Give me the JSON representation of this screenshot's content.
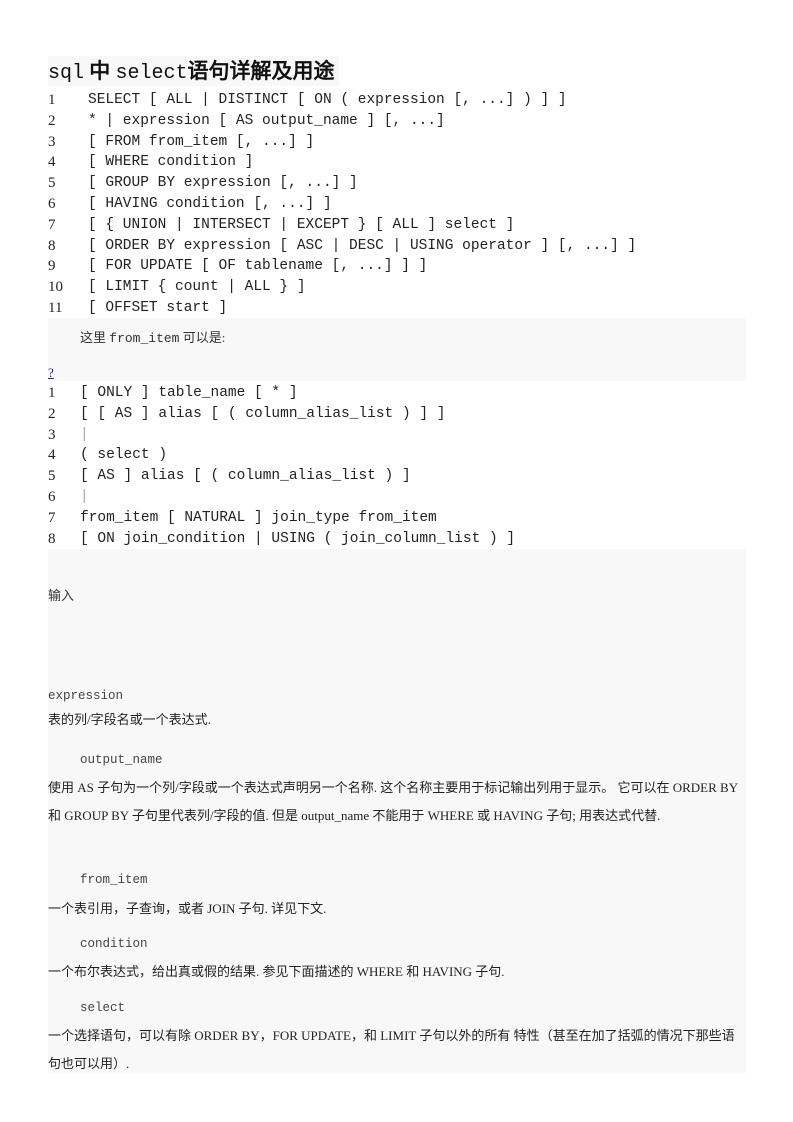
{
  "document": {
    "title": {
      "part1": "sql",
      "part2": "中",
      "part3": "select",
      "part4": "语句详解及用途"
    },
    "syntax_listing": [
      {
        "n": "1",
        "text": "SELECT [ ALL | DISTINCT [ ON ( expression [, ...] ) ] ]"
      },
      {
        "n": "2",
        "text": "* | expression [ AS output_name ] [, ...]"
      },
      {
        "n": "3",
        "text": "[ FROM from_item [, ...] ]"
      },
      {
        "n": "4",
        "text": "[ WHERE condition ]"
      },
      {
        "n": "5",
        "text": "[ GROUP BY expression [, ...] ]"
      },
      {
        "n": "6",
        "text": "[ HAVING condition [, ...] ]"
      },
      {
        "n": "7",
        "text": "[ { UNION | INTERSECT | EXCEPT } [ ALL ] select ]"
      },
      {
        "n": "8",
        "text": "[ ORDER BY expression [ ASC | DESC | USING operator ] [, ...] ]"
      },
      {
        "n": "9",
        "text": "[ FOR UPDATE [ OF tablename [, ...] ] ]"
      },
      {
        "n": "10",
        "text": "[ LIMIT { count | ALL } ]"
      },
      {
        "n": "11",
        "text": "[ OFFSET start ]"
      }
    ],
    "from_item_note": {
      "prefix": "这里",
      "term": "from_item",
      "suffix": "可以是:"
    },
    "help_link": "?",
    "from_item_listing": [
      {
        "n": "1",
        "text": "[ ONLY ] table_name [ * ]"
      },
      {
        "n": "2",
        "text": "[ [ AS ] alias [ ( column_alias_list ) ] ]"
      },
      {
        "n": "3",
        "text": "|"
      },
      {
        "n": "4",
        "text": "( select )"
      },
      {
        "n": "5",
        "text": "[ AS ] alias [ ( column_alias_list ) ]"
      },
      {
        "n": "6",
        "text": "|"
      },
      {
        "n": "7",
        "text": "from_item [ NATURAL ] join_type from_item"
      },
      {
        "n": "8",
        "text": "[ ON join_condition | USING ( join_column_list ) ]"
      }
    ],
    "inputs_heading": "输入",
    "parameters": [
      {
        "term": "expression",
        "description": "表的列/字段名或一个表达式."
      },
      {
        "term": "output_name",
        "description": "使用 AS 子句为一个列/字段或一个表达式声明另一个名称. 这个名称主要用于标记输出列用于显示。 它可以在 ORDER BY 和 GROUP BY 子句里代表列/字段的值. 但是 output_name 不能用于 WHERE 或 HAVING 子句; 用表达式代替."
      },
      {
        "term": "from_item",
        "description": "一个表引用，子查询，或者 JOIN 子句. 详见下文."
      },
      {
        "term": "condition",
        "description": "一个布尔表达式，给出真或假的结果. 参见下面描述的 WHERE 和 HAVING 子句."
      },
      {
        "term": "select",
        "description": "一个选择语句，可以有除 ORDER BY，FOR UPDATE，和 LIMIT 子句以外的所有 特性（甚至在加了括弧的情况下那些语句也可以用）."
      }
    ]
  }
}
